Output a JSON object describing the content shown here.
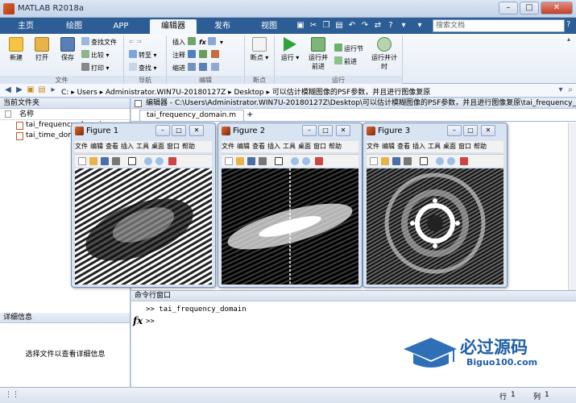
{
  "window": {
    "title": "MATLAB R2018a",
    "min": "–",
    "max": "□",
    "close": "✕"
  },
  "tabs": [
    "主页",
    "绘图",
    "APP",
    "编辑器",
    "发布",
    "视图"
  ],
  "active_tab": 3,
  "search": {
    "placeholder": "搜索文档"
  },
  "help": "?",
  "ribbon": {
    "new": "新建",
    "open": "打开",
    "save": "保存",
    "find_files": "查找文件",
    "compare": "比较",
    "print": "打印",
    "goto": "转至",
    "find": "查找",
    "insert": "插入",
    "fx": "fx",
    "comment": "注释",
    "indent": "缩进",
    "breakpoint": "断点",
    "run": "运行",
    "run_advance": "运行并前进",
    "run_section": "运行节",
    "advance": "前进",
    "run_time": "运行并计时",
    "sections": {
      "file": "文件",
      "navigate": "导航",
      "edit": "编辑",
      "breakpoint": "断点",
      "run": "运行"
    }
  },
  "path": {
    "segments": [
      "C:",
      "Users",
      "Administrator.WIN7U-20180127Z",
      "Desktop",
      "可以估计模糊图像的PSF参数，并且进行图像复原"
    ]
  },
  "current_folder": {
    "title": "当前文件夹",
    "column": "名称",
    "files": [
      "tai_frequency_domain.m",
      "tai_time_domain.m"
    ]
  },
  "details": {
    "title": "详细信息",
    "hint": "选择文件以查看详细信息"
  },
  "editor": {
    "title": "编辑器 - C:\\Users\\Administrator.WIN7U-20180127Z\\Desktop\\可以估计模糊图像的PSF参数，并且进行图像复原\\tai_frequency_domain.m",
    "tab": "tai_frequency_domain.m",
    "add_tab": "+"
  },
  "figures": [
    {
      "title": "Figure 1"
    },
    {
      "title": "Figure 2"
    },
    {
      "title": "Figure 3"
    }
  ],
  "figure_menu": [
    "文件",
    "编辑",
    "查看",
    "插入",
    "工具",
    "桌面",
    "窗口",
    "帮助"
  ],
  "command_window": {
    "title": "命令行窗口",
    "lines": [
      ">> tai_frequency_domain",
      ">>"
    ],
    "fx": "fx"
  },
  "watermark": {
    "name": "必过源码",
    "url": "Biguo100.com"
  },
  "status": {
    "row_label": "行",
    "row": "1",
    "col_label": "列",
    "col": "1"
  },
  "colors": {
    "tab_strip": "#2c5d95",
    "ribbon": "#eef2f8",
    "accent": "#e0662b"
  }
}
